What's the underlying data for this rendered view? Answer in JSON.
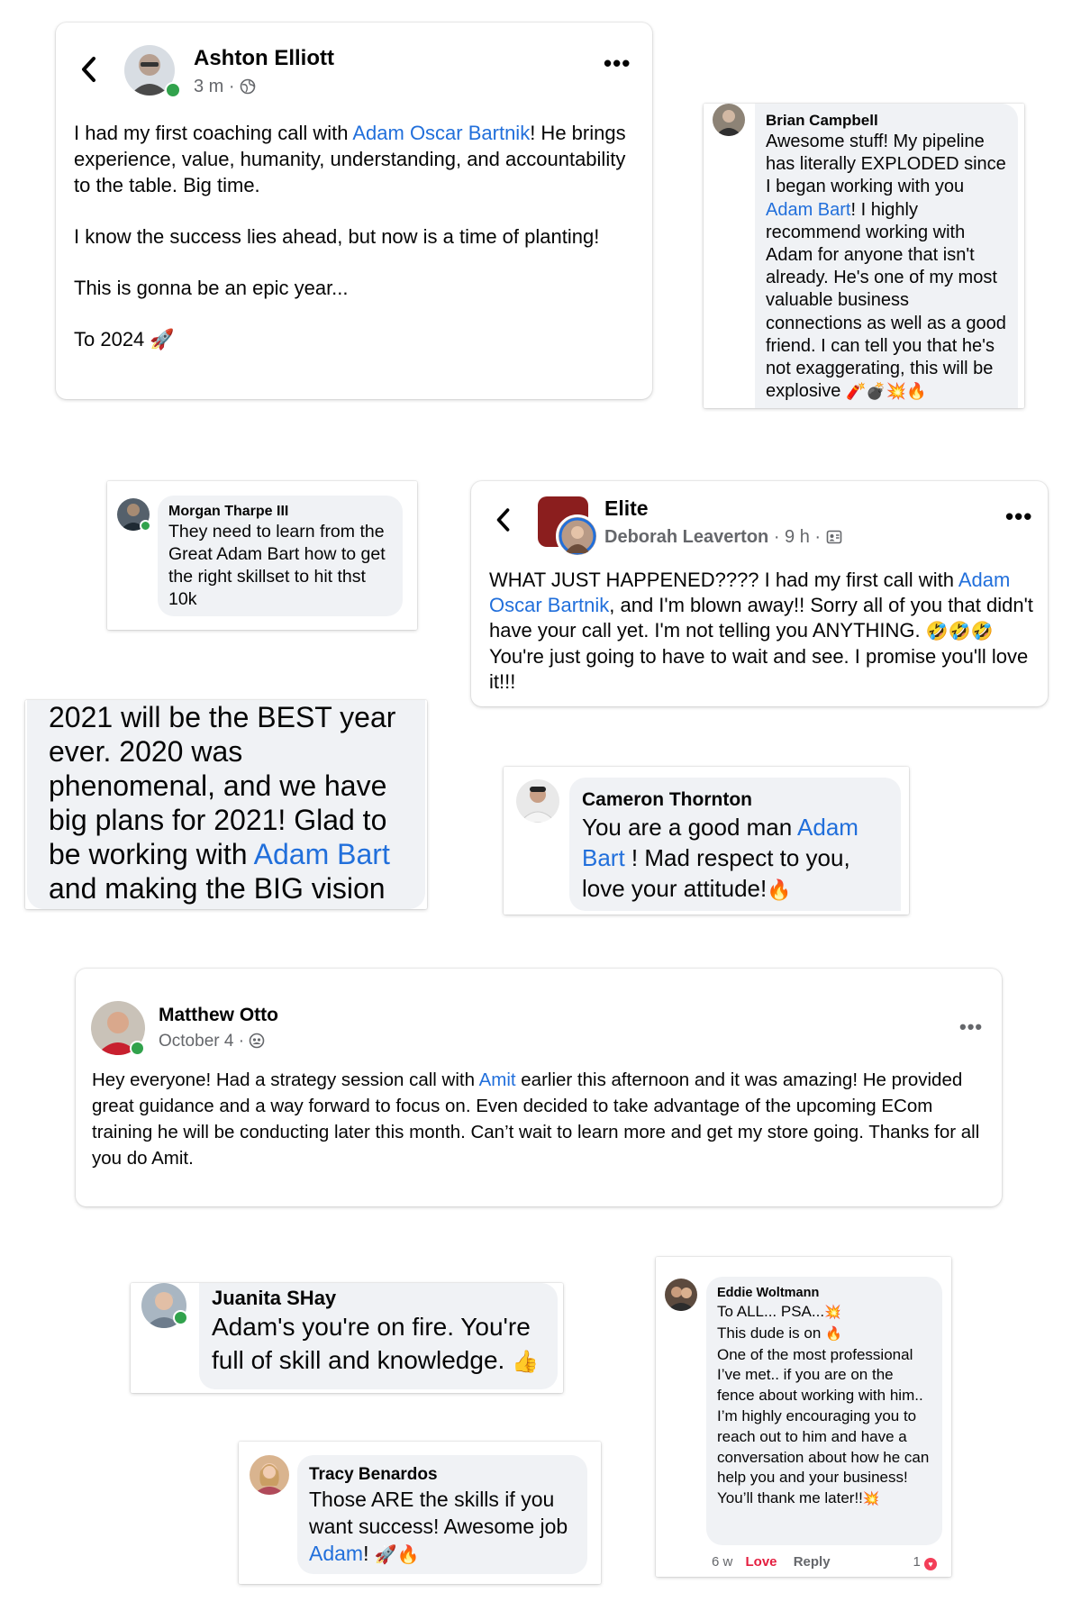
{
  "ashton": {
    "name": "Ashton Elliott",
    "time": "3 m",
    "p1_a": "I had my first coaching call with ",
    "p1_link": "Adam Oscar Bartnik",
    "p1_b": "! He brings experience, value, humanity, understanding, and accountability to the table. Big time.",
    "p2": "I know the success lies ahead, but now is a time of planting!",
    "p3": "This is gonna be an epic year...",
    "p4": "To 2024",
    "p4_emoji": "🚀"
  },
  "brian": {
    "name": "Brian Campbell",
    "a": "Awesome stuff! My pipeline has literally EXPLODED since I began working with you ",
    "link": "Adam Bart",
    "b": "! I highly recommend working with Adam for anyone that isn't already. He's one of my most valuable business connections as well as a good friend. I can tell you that he's not exaggerating, this will be explosive",
    "emoji": "🧨💣💥🔥"
  },
  "morgan": {
    "name": "Morgan Tharpe III",
    "text": "They need to learn from the Great Adam Bart how to get the right skillset to hit thst 10k"
  },
  "elite": {
    "group": "Elite",
    "author": "Deborah Leaverton",
    "time": "9 h",
    "a": "WHAT JUST HAPPENED???? I had my first call with ",
    "link": "Adam Oscar Bartnik",
    "b": ", and I'm blown away!! Sorry all of you that didn't have your call yet. I'm not telling you ANYTHING. ",
    "emoji": "🤣🤣🤣",
    "c": " You're just going to have to wait and see. I promise you'll love it!!!"
  },
  "big_quote": {
    "a": "2021 will be the BEST year ever. 2020 was phenomenal, and we have big plans for 2021! Glad to be working with ",
    "link": "Adam Bart",
    "b": " and making the BIG vision happen!"
  },
  "cameron": {
    "name": "Cameron Thornton",
    "a": "You are a good man ",
    "link": "Adam Bart",
    "b": " ! Mad respect to you, love your attitude!",
    "emoji": "🔥"
  },
  "matthew": {
    "name": "Matthew Otto",
    "time": "October 4",
    "a": "Hey everyone! Had a strategy session call with ",
    "link": "Amit",
    "b": " earlier this afternoon and it was amazing! He provided great guidance and a way forward to focus on. Even decided to take advantage of the upcoming ECom training he will be conducting later this month. Can’t wait to learn more and get my store going. Thanks for all you do Amit."
  },
  "juanita": {
    "name": "Juanita SHay",
    "text": "Adam's you're on fire.  You're full of skill and knowledge.",
    "emoji": "👍"
  },
  "tracy": {
    "name": "Tracy Benardos",
    "a": "Those ARE the skills if you want success! Awesome job ",
    "link": "Adam",
    "b": "!",
    "emoji": "🚀🔥"
  },
  "eddie": {
    "name": "Eddie Woltmann",
    "l1": "To ALL... PSA...",
    "l1_emoji": "💥",
    "l2": "This dude is on",
    "l2_emoji": "🔥",
    "l3": "One of the most professional I’ve met.. if you are on the fence about working with him.. I’m highly encouraging you to reach out to him and have a conversation about how he can help you and your business! You’ll thank me later!!",
    "l3_emoji": "💥",
    "time": "6 w",
    "love": "Love",
    "reply": "Reply",
    "count": "1"
  },
  "colors": {
    "link": "#216fdb",
    "bubble": "#f0f2f5",
    "online": "#31a24c",
    "meta": "#65676b"
  }
}
